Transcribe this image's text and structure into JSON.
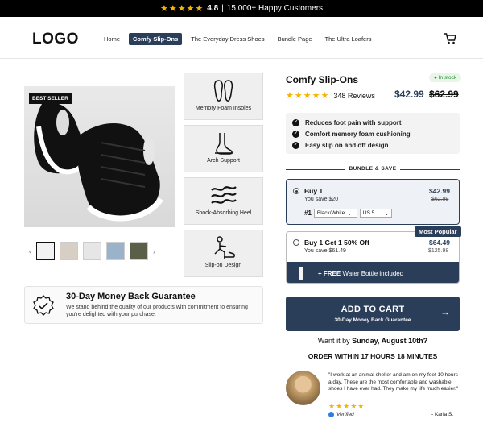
{
  "topbar": {
    "stars": "★★★★★",
    "rating": "4.8",
    "separator": "|",
    "customers": "15,000+ Happy Customers"
  },
  "header": {
    "logo": "LOGO",
    "nav": [
      {
        "label": "Home",
        "active": false
      },
      {
        "label": "Comfy Slip-Ons",
        "active": true
      },
      {
        "label": "The Everyday Dress Shoes",
        "active": false
      },
      {
        "label": "Bundle Page",
        "active": false
      },
      {
        "label": "The Ultra Loafers",
        "active": false
      }
    ]
  },
  "gallery": {
    "badge": "BEST SELLER",
    "prev": "‹",
    "next": "›",
    "thumbnails": 5
  },
  "features": [
    {
      "label": "Memory Foam Insoles",
      "icon": "insoles-icon"
    },
    {
      "label": "Arch Support",
      "icon": "foot-arch-icon"
    },
    {
      "label": "Shock-Absorbing Heel",
      "icon": "waves-icon"
    },
    {
      "label": "Slip-on Design",
      "icon": "person-shoe-icon"
    }
  ],
  "guarantee": {
    "title": "30-Day Money Back Guarantee",
    "text": "We stand behind the quality of our products with commitment to ensuring you're delighted with your purchase."
  },
  "product": {
    "title": "Comfy Slip-Ons",
    "stock": "In stock",
    "stars": "★★★★★",
    "reviews": "348 Reviews",
    "price": "$42.99",
    "old_price": "$62.99",
    "benefits": [
      "Reduces foot pain with support",
      "Comfort memory foam cushioning",
      "Easy slip on and off design"
    ]
  },
  "bundle": {
    "label": "BUNDLE & SAVE",
    "option1": {
      "title": "Buy 1",
      "save": "You save $20",
      "price": "$42.99",
      "old": "$62.99",
      "index": "#1",
      "color": "Black/White",
      "size": "US 5"
    },
    "popular": "Most Popular",
    "option2": {
      "title": "Buy 1 Get 1 50% Off",
      "save": "You save $61.49",
      "price": "$64.49",
      "old": "$125.98",
      "free_prefix": "+ FREE",
      "free_text": " Water Bottle included"
    }
  },
  "cta": {
    "label": "ADD TO CART",
    "sub": "30-Day Money Back Guarantee",
    "arrow": "→"
  },
  "delivery": {
    "prefix": "Want it by ",
    "date": "Sunday, August 10th?",
    "order": "ORDER WITHIN 17 HOURS 18 MINUTES"
  },
  "review": {
    "text": "\"I work at an animal shelter and am on my feet 10 hours a day. These are the most comfortable and washable shoes I have ever had. They make my life much easier.\"",
    "stars": "★★★★★",
    "verified": "Verified",
    "author": "- Karla S."
  },
  "colors": {
    "accent": "#2a3e5a",
    "star": "#f5b400",
    "stock_green": "#2c8a3a"
  }
}
